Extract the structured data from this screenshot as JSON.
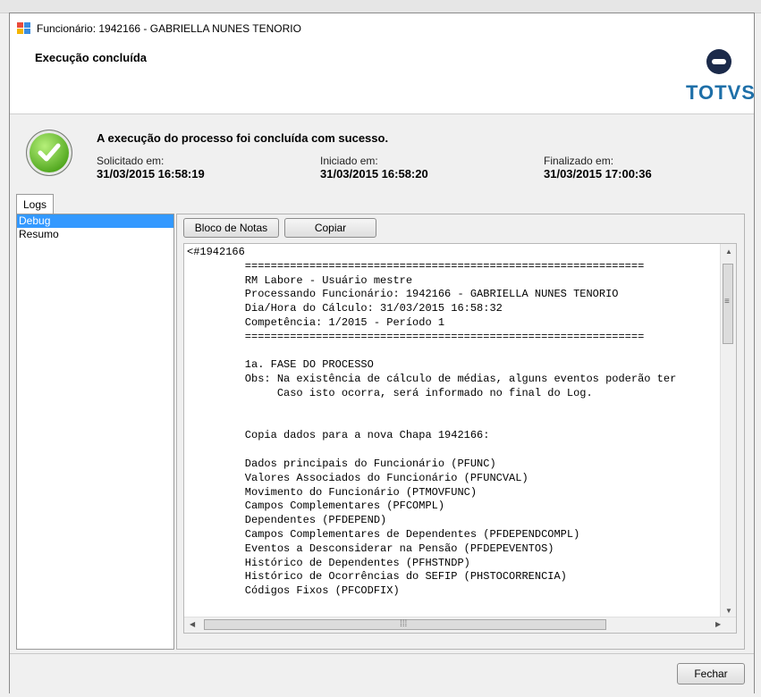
{
  "window": {
    "title": "Funcionário: 1942166 - GABRIELLA NUNES TENORIO"
  },
  "header": {
    "title": "Execução concluída",
    "logo": "TOTVS"
  },
  "status": {
    "message": "A execução do processo foi concluída com sucesso.",
    "requested_label": "Solicitado em:",
    "requested_value": "31/03/2015 16:58:19",
    "started_label": "Iniciado em:",
    "started_value": "31/03/2015 16:58:20",
    "finished_label": "Finalizado em:",
    "finished_value": "31/03/2015 17:00:36",
    "icon": "success-check-icon"
  },
  "tabs": {
    "logs": "Logs"
  },
  "log_list": [
    "Debug",
    "Resumo"
  ],
  "toolbar": {
    "notepad": "Bloco de Notas",
    "copy": "Copiar"
  },
  "log_text": "<#1942166\n         ==============================================================\n         RM Labore - Usuário mestre\n         Processando Funcionário: 1942166 - GABRIELLA NUNES TENORIO\n         Dia/Hora do Cálculo: 31/03/2015 16:58:32\n         Competência: 1/2015 - Período 1\n         ==============================================================\n\n         1a. FASE DO PROCESSO\n         Obs: Na existência de cálculo de médias, alguns eventos poderão ter\n              Caso isto ocorra, será informado no final do Log.\n\n\n         Copia dados para a nova Chapa 1942166:\n\n         Dados principais do Funcionário (PFUNC)\n         Valores Associados do Funcionário (PFUNCVAL)\n         Movimento do Funcionário (PTMOVFUNC)\n         Campos Complementares (PFCOMPL)\n         Dependentes (PFDEPEND)\n         Campos Complementares de Dependentes (PFDEPENDCOMPL)\n         Eventos a Desconsiderar na Pensão (PFDEPEVENTOS)\n         Histórico de Dependentes (PFHSTNDP)\n         Histórico de Ocorrências do SEFIP (PHSTOCORRENCIA)\n         Códigos Fixos (PFCODFIX)",
  "footer": {
    "close": "Fechar"
  },
  "colors": {
    "selection": "#3399ff",
    "logo_blue": "#1e6fa8",
    "success_green": "#4ea51c"
  }
}
